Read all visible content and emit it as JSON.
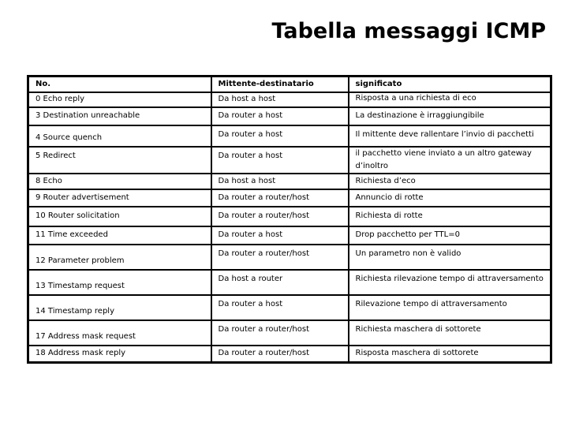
{
  "title": "Tabella messaggi ICMP",
  "table": {
    "headers": [
      "No.",
      "Mittente-destinatario",
      "significato"
    ],
    "rows": [
      {
        "type": "0 Echo reply",
        "direction": "Da host a host",
        "meaning": "Risposta a una richiesta di eco"
      },
      {
        "type": "3 Destination unreachable",
        "direction": "Da router a host",
        "meaning": "La destinazione è irraggiungibile"
      },
      {
        "type": "4 Source quench",
        "direction": "Da router a host",
        "meaning": "Il mittente deve rallentare l’invio di pacchetti"
      },
      {
        "type": "5 Redirect",
        "direction": "Da router a host",
        "meaning": "il pacchetto viene inviato a un altro gateway d’inoltro"
      },
      {
        "type": "8 Echo",
        "direction": "Da host a host",
        "meaning": "Richiesta d’eco"
      },
      {
        "type": "9 Router advertisement",
        "direction": "Da router a router/host",
        "meaning": "Annuncio di rotte"
      },
      {
        "type": "10 Router solicitation",
        "direction": "Da router a router/host",
        "meaning": "Richiesta di rotte"
      },
      {
        "type": "11 Time exceeded",
        "direction": "Da router a host",
        "meaning": "Drop pacchetto per TTL=0"
      },
      {
        "type": "12 Parameter problem",
        "direction": "Da router a router/host",
        "meaning": "Un parametro non è valido"
      },
      {
        "type": "13 Timestamp request",
        "direction": "Da host a router",
        "meaning": "Richiesta rilevazione tempo di attraversamento"
      },
      {
        "type": "14 Timestamp reply",
        "direction": "Da router a host",
        "meaning": "Rilevazione tempo di attraversamento"
      },
      {
        "type": "17 Address mask request",
        "direction": "Da router a router/host",
        "meaning": "Richiesta maschera di sottorete"
      },
      {
        "type": "18 Address mask reply",
        "direction": "Da router a router/host",
        "meaning": "Risposta maschera di sottorete"
      }
    ]
  }
}
